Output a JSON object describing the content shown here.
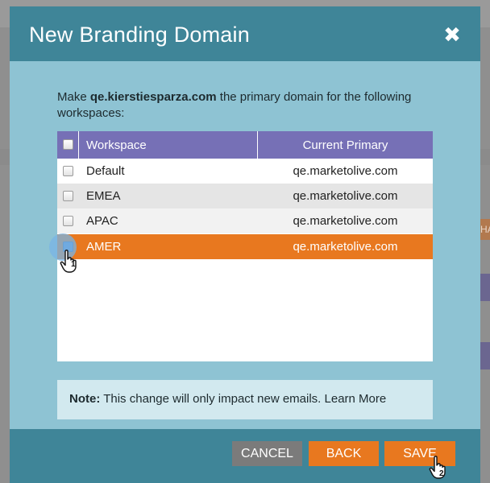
{
  "dialog": {
    "title": "New Branding Domain",
    "close_icon": "close-icon",
    "intro_prefix": "Make ",
    "intro_domain": "qe.kierstiesparza.com",
    "intro_suffix": " the primary domain for the following workspaces:"
  },
  "table": {
    "columns": [
      "Workspace",
      "Current Primary"
    ],
    "rows": [
      {
        "workspace": "Default",
        "current_primary": "qe.marketolive.com",
        "checked": false
      },
      {
        "workspace": "EMEA",
        "current_primary": "qe.marketolive.com",
        "checked": false
      },
      {
        "workspace": "APAC",
        "current_primary": "qe.marketolive.com",
        "checked": false
      },
      {
        "workspace": "AMER",
        "current_primary": "qe.marketolive.com",
        "checked": true
      }
    ]
  },
  "note": {
    "label": "Note:",
    "text": " This change will only impact new emails. ",
    "link": "Learn More"
  },
  "buttons": {
    "cancel": "CANCEL",
    "back": "BACK",
    "save": "SAVE"
  },
  "callouts": {
    "step1": "1",
    "step2": "2"
  },
  "background": {
    "side_text": "HA"
  },
  "colors": {
    "header": "#3f8598",
    "dialog_body": "#8ec3d3",
    "table_header": "#7670b6",
    "selected_row": "#e8781f",
    "button_orange": "#e8781f",
    "button_gray": "#7b7b7b"
  }
}
